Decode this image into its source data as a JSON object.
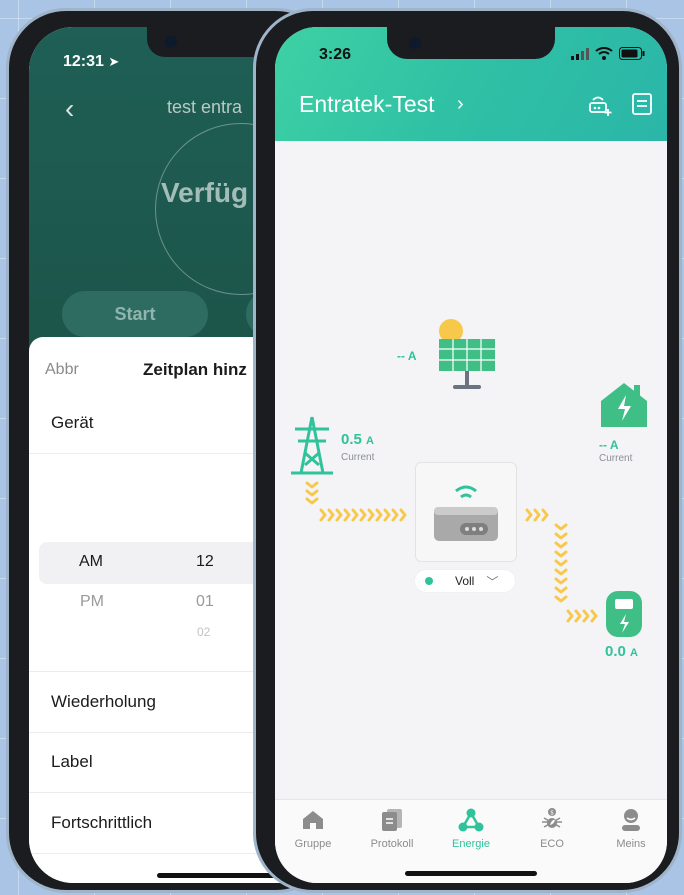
{
  "left_screen": {
    "status_time": "12:31",
    "title": "test entra",
    "status_text": "Verfüg",
    "start_label": "Start",
    "sheet": {
      "cancel_label": "Abbr",
      "title": "Zeitplan hinz",
      "device_label": "Gerät",
      "picker": {
        "ampm": [
          "AM",
          "PM"
        ],
        "hours": [
          "12",
          "01",
          "02"
        ]
      },
      "repeat_label": "Wiederholung",
      "label_label": "Label",
      "advanced_label": "Fortschrittlich"
    }
  },
  "right_screen": {
    "status_time": "3:26",
    "title": "Entratek-Test",
    "solar": {
      "value": "-- A"
    },
    "grid": {
      "value": "0.5",
      "unit": "A",
      "sub": "Current"
    },
    "home": {
      "value": "-- A",
      "sub": "Current"
    },
    "charger": {
      "value": "0.0",
      "unit": "A"
    },
    "mode": {
      "label": "Voll"
    },
    "colors": {
      "accent": "#2fc29b",
      "flow": "#f7c84a"
    },
    "tabs": [
      {
        "label": "Gruppe",
        "icon": "home-icon"
      },
      {
        "label": "Protokoll",
        "icon": "document-icon"
      },
      {
        "label": "Energie",
        "icon": "energy-icon",
        "active": true
      },
      {
        "label": "ECO",
        "icon": "eco-icon"
      },
      {
        "label": "Meins",
        "icon": "user-icon"
      }
    ]
  }
}
